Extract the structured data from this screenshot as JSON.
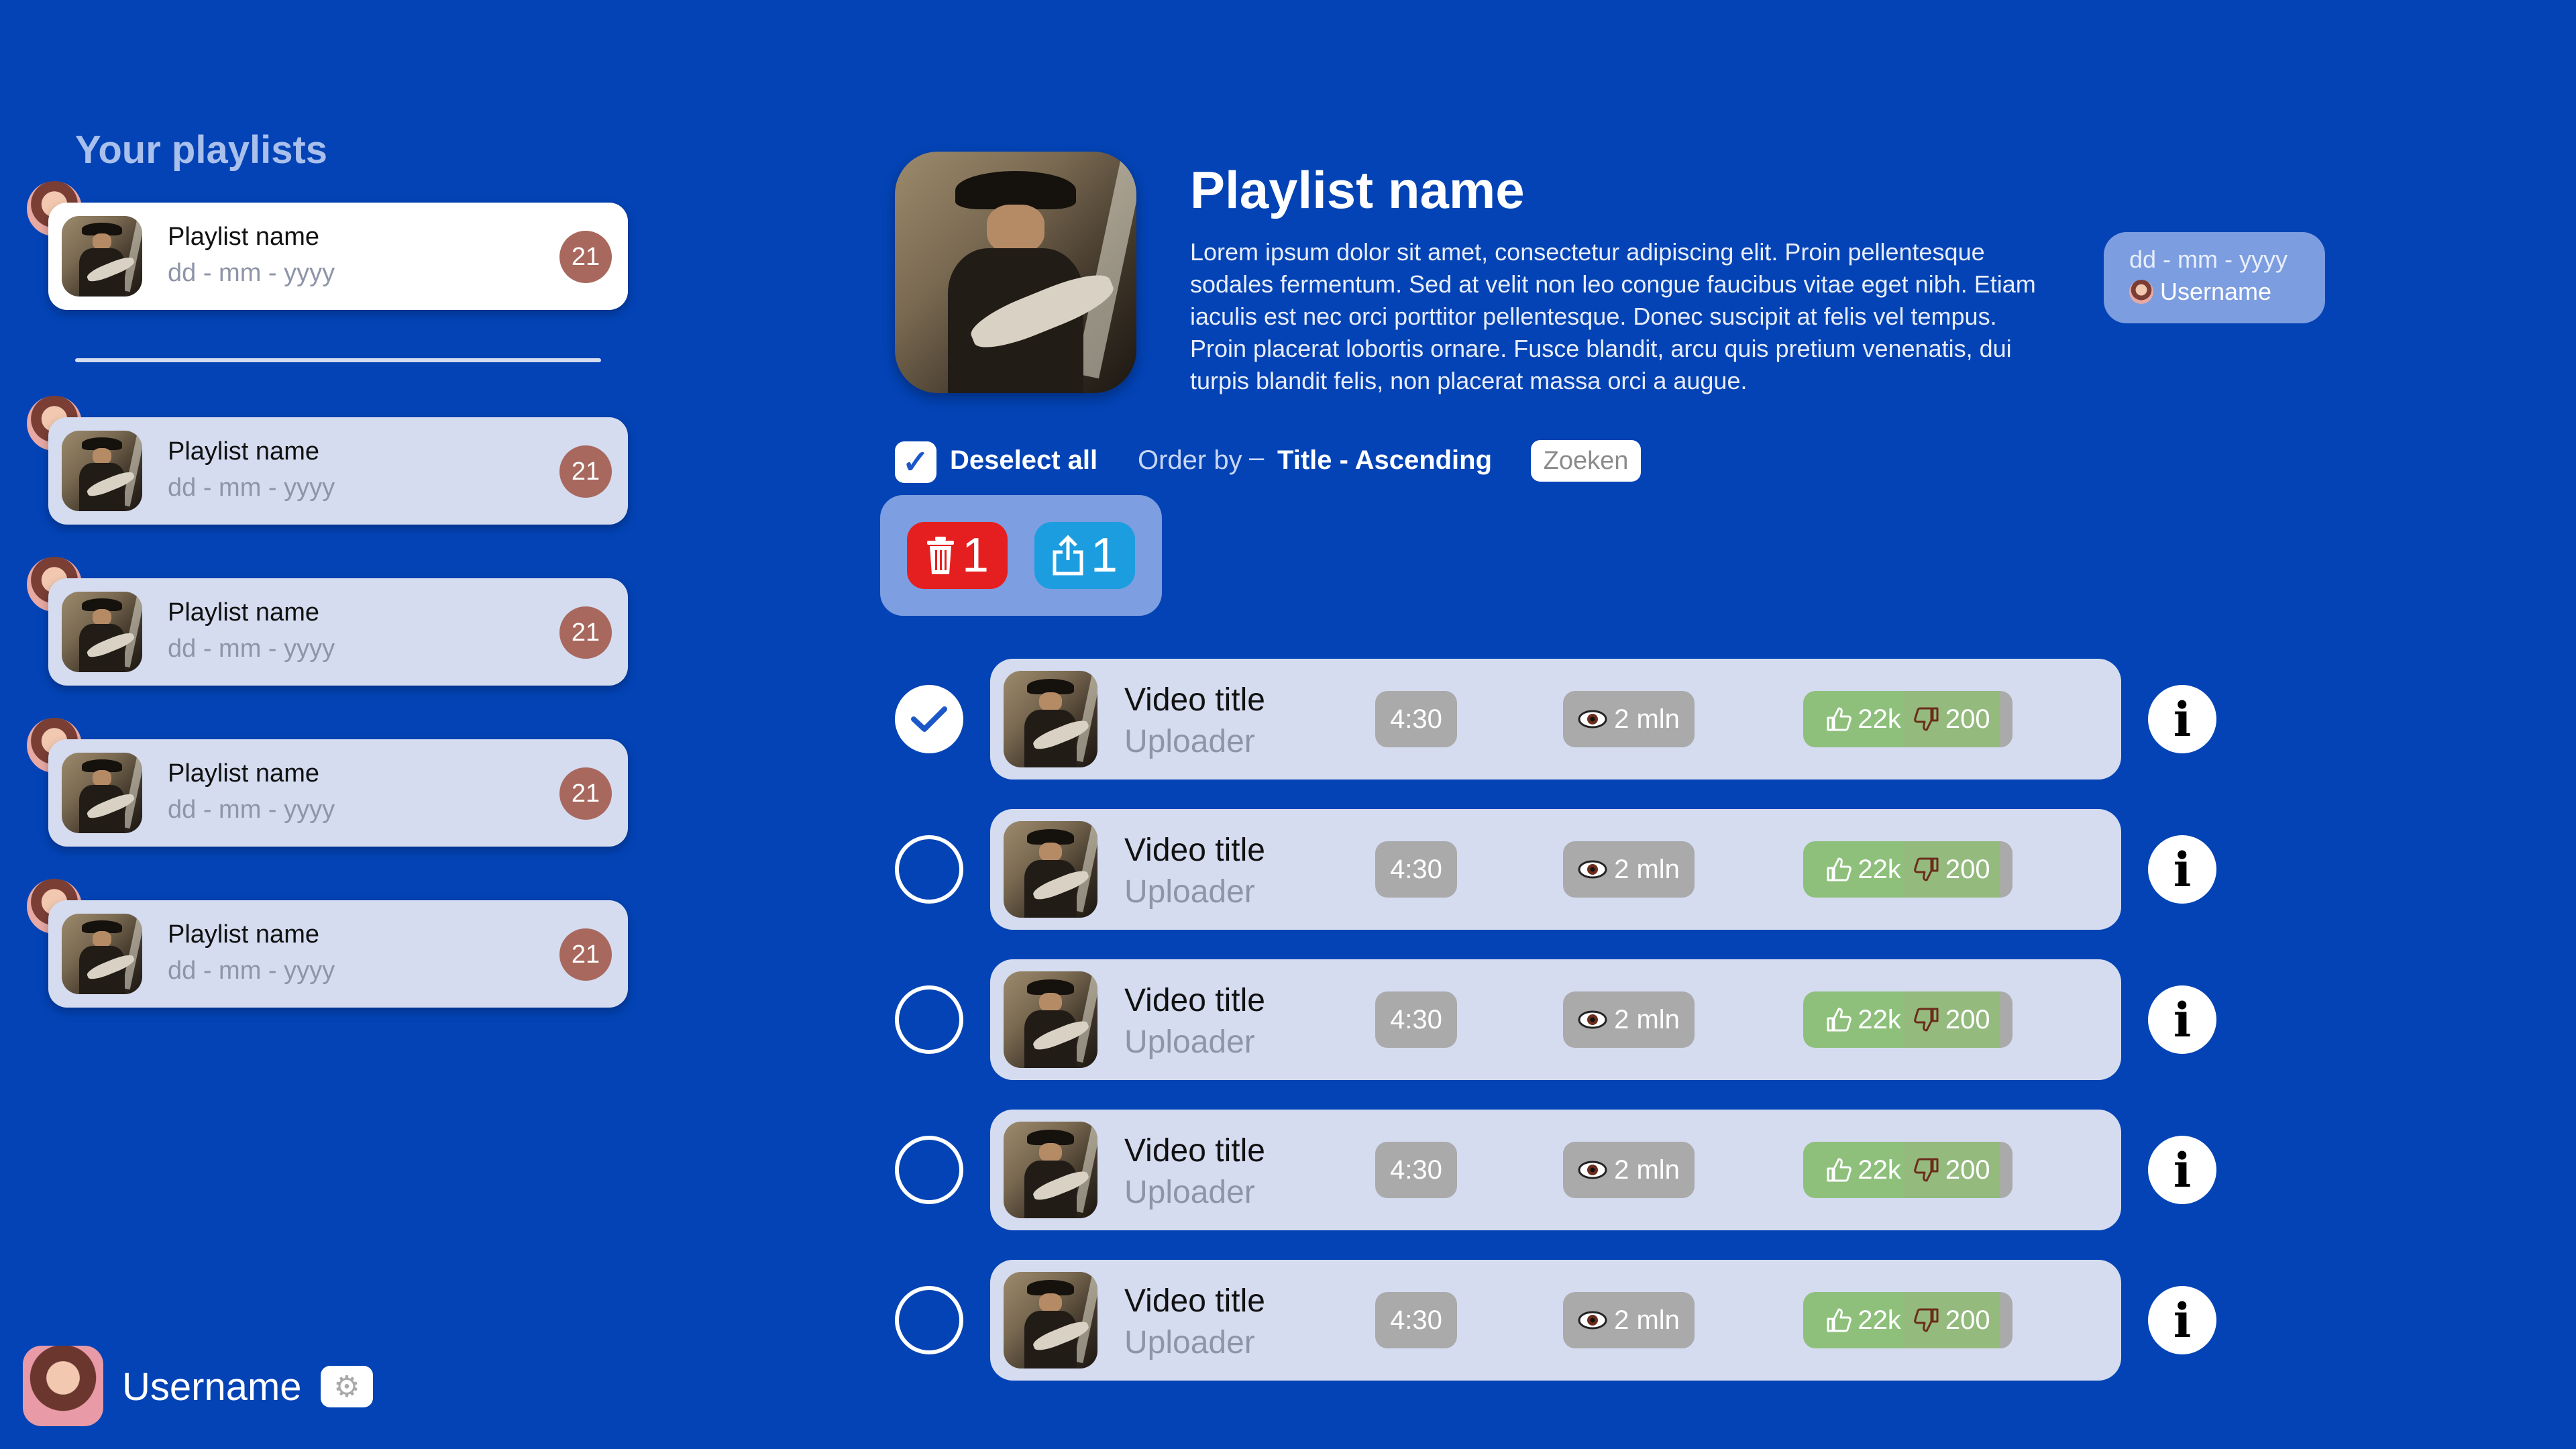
{
  "sidebar": {
    "title": "Your playlists",
    "active_playlist": {
      "name": "Playlist name",
      "date": "dd - mm - yyyy",
      "count": "21"
    },
    "playlists": [
      {
        "name": "Playlist name",
        "date": "dd - mm - yyyy",
        "count": "21"
      },
      {
        "name": "Playlist name",
        "date": "dd - mm - yyyy",
        "count": "21"
      },
      {
        "name": "Playlist name",
        "date": "dd - mm - yyyy",
        "count": "21"
      },
      {
        "name": "Playlist name",
        "date": "dd - mm - yyyy",
        "count": "21"
      }
    ]
  },
  "user": {
    "username": "Username",
    "settings_icon": "gear-icon"
  },
  "playlist": {
    "title": "Playlist name",
    "description": "Lorem ipsum dolor sit amet, consectetur adipiscing elit. Proin pellentesque sodales fermentum. Sed at velit non leo congue faucibus vitae eget nibh. Etiam iaculis est nec orci porttitor pellentesque. Donec suscipit at felis vel tempus. Proin placerat lobortis ornare. Fusce blandit, arcu quis pretium venenatis, dui turpis blandit felis, non placerat massa orci a augue.",
    "meta_date": "dd - mm - yyyy",
    "meta_user": "Username"
  },
  "controls": {
    "deselect_label": "Deselect all",
    "order_label": "Order by",
    "order_dash": "–",
    "order_value": "Title - Ascending",
    "search_label": "Zoeken",
    "delete_count": "1",
    "share_count": "1"
  },
  "videos": [
    {
      "title": "Video title",
      "uploader": "Uploader",
      "duration": "4:30",
      "views": "2 mln",
      "likes": "22k",
      "dislikes": "200",
      "selected": true
    },
    {
      "title": "Video title",
      "uploader": "Uploader",
      "duration": "4:30",
      "views": "2 mln",
      "likes": "22k",
      "dislikes": "200",
      "selected": false
    },
    {
      "title": "Video title",
      "uploader": "Uploader",
      "duration": "4:30",
      "views": "2 mln",
      "likes": "22k",
      "dislikes": "200",
      "selected": false
    },
    {
      "title": "Video title",
      "uploader": "Uploader",
      "duration": "4:30",
      "views": "2 mln",
      "likes": "22k",
      "dislikes": "200",
      "selected": false
    },
    {
      "title": "Video title",
      "uploader": "Uploader",
      "duration": "4:30",
      "views": "2 mln",
      "likes": "22k",
      "dislikes": "200",
      "selected": false
    }
  ],
  "colors": {
    "background": "#0343b5",
    "card": "#d5dcf0",
    "like_green": "#8ec07c",
    "dislike_green": "#94ba7e",
    "delete_red": "#e51f1f",
    "share_blue": "#1c9de0",
    "count_badge": "#a8685e"
  }
}
